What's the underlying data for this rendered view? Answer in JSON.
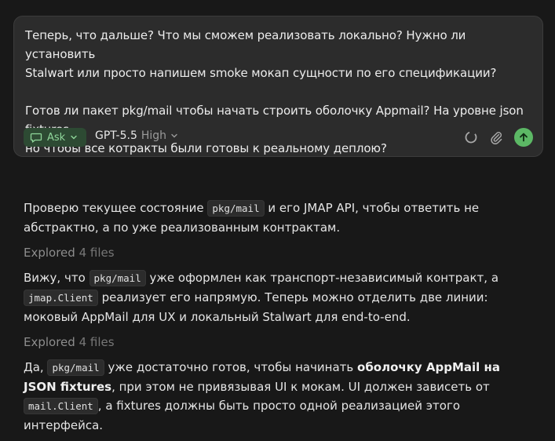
{
  "composer": {
    "line1": "Теперь, что дальше? Что мы сможем реализовать локально? Нужно ли установить",
    "line2": "Stalwart  или просто напишем smoke мокап сущности по его спецификации?",
    "line3": "Готов ли пакет pkg/mail чтобы начать строить оболочку Appmail? На уровне json fixtures",
    "line4": "но чтобы все котракты были готовы к реальному деплою?",
    "mode_label": "Ask",
    "model_name": "GPT-5.5",
    "effort": "High"
  },
  "transcript": {
    "p1_a": "Проверю текущее состояние ",
    "p1_code": "pkg/mail",
    "p1_b": " и его JMAP API, чтобы ответить не абстрактно, а по уже реализованным контрактам.",
    "explored1_label": "Explored",
    "explored1_count": "4 files",
    "p2_a": "Вижу, что ",
    "p2_code1": "pkg/mail",
    "p2_b": " уже оформлен как транспорт-независимый контракт, а ",
    "p2_code2": "jmap.Client",
    "p2_c": " реализует его напрямую. Теперь можно отделить две линии: моковый AppMail для UX и локальный Stalwart для end-to-end.",
    "explored2_label": "Explored",
    "explored2_count": "4 files",
    "p3_a": "Да, ",
    "p3_code1": "pkg/mail",
    "p3_b": " уже достаточно готов, чтобы начинать ",
    "p3_bold": "оболочку AppMail на JSON fixtures",
    "p3_c": ", при этом не привязывая UI к мокам. UI должен зависеть от ",
    "p3_code2": "mail.Client",
    "p3_d": ", а fixtures должны быть просто одной реализацией этого интерфейса."
  },
  "icons": {
    "mode": "chat-bubble-icon",
    "mode_chevron": "chevron-down-icon",
    "model_chevron": "chevron-down-icon",
    "loading": "spinner-icon",
    "attach": "paperclip-icon",
    "send": "arrow-up-icon"
  },
  "colors": {
    "background": "#181818",
    "composer": "#2c2c2c",
    "accent": "#5cb865",
    "ask_bg": "#2d4a33",
    "ask_text": "#8fd69a"
  }
}
